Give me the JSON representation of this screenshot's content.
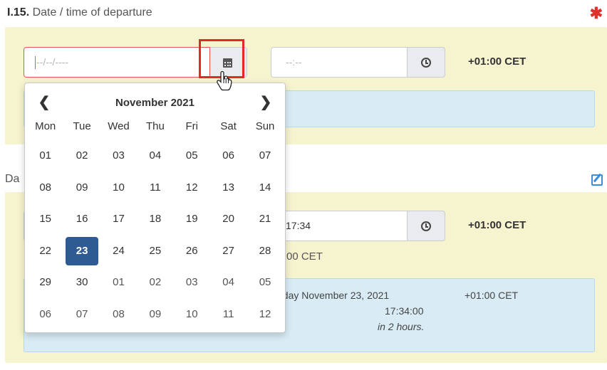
{
  "section": {
    "code": "I.15.",
    "title": " Date / time of departure",
    "required_mark": "✱"
  },
  "departure": {
    "date_placeholder": "--/--/----",
    "time_placeholder": "--:--",
    "timezone": "+01:00 CET"
  },
  "second_section": {
    "label_partial": "Da",
    "time_value": "17:34",
    "timezone": "+01:00 CET",
    "timezone_note": "00 CET",
    "info": {
      "date_text": "esday November 23, 2021",
      "time_text": "17:34:00",
      "relative_text": "in 2 hours.",
      "timezone": "+01:00 CET"
    }
  },
  "datepicker": {
    "prev_label": "❮",
    "next_label": "❯",
    "month_title": "November 2021",
    "weekdays": [
      "Mon",
      "Tue",
      "Wed",
      "Thu",
      "Fri",
      "Sat",
      "Sun"
    ],
    "weeks": [
      [
        "01",
        "02",
        "03",
        "04",
        "05",
        "06",
        "07"
      ],
      [
        "08",
        "09",
        "10",
        "11",
        "12",
        "13",
        "14"
      ],
      [
        "15",
        "16",
        "17",
        "18",
        "19",
        "20",
        "21"
      ],
      [
        "22",
        "23",
        "24",
        "25",
        "26",
        "27",
        "28"
      ],
      [
        "29",
        "30",
        "01",
        "02",
        "03",
        "04",
        "05"
      ],
      [
        "06",
        "07",
        "08",
        "09",
        "10",
        "11",
        "12"
      ]
    ],
    "selected_day": "23"
  },
  "icons": {
    "calendar": "calendar-icon",
    "clock": "clock-icon",
    "edit": "edit-icon",
    "cursor": "hand-pointer-cursor"
  },
  "colors": {
    "panel_bg": "#f6f3cf",
    "info_bg": "#d9ecf6",
    "selected_day_bg": "#2e5c92",
    "required": "#e0302c",
    "error_border": "#e8554f",
    "highlight_border": "#e02a2a"
  }
}
